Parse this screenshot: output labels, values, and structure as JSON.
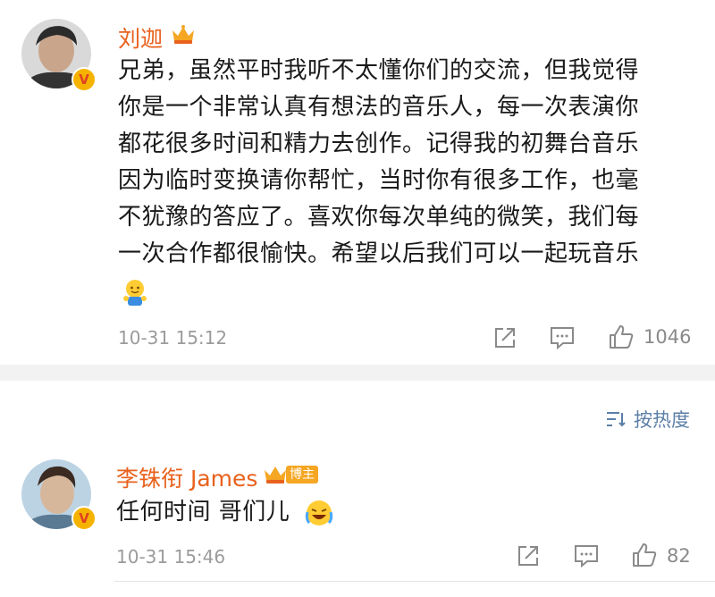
{
  "comments": [
    {
      "username": "刘迦",
      "body_lines": [
        "兄弟，虽然平时我听不太懂你们的交流，但我觉得",
        "你是一个非常认真有想法的音乐人，每一次表演你",
        "都花很多时间和精力去创作。记得我的初舞台音乐",
        "因为临时变换请你帮忙，当时你有很多工作，也毫",
        "不犹豫的答应了。喜欢你每次单纯的微笑，我们每",
        "一次合作都很愉快。希望以后我们可以一起玩音乐"
      ],
      "emoji": "hug-emoji",
      "time": "10-31 15:12",
      "likes": "1046",
      "verified_mark": "V"
    },
    {
      "username": "李铢衔 James",
      "tag": "博主",
      "body": "任何时间 哥们儿",
      "emoji": "laughing-cry-emoji",
      "time": "10-31 15:46",
      "likes": "82",
      "verified_mark": "V"
    }
  ],
  "sort_label": "按热度",
  "icons": {
    "share": "share-icon",
    "comment": "comment-icon",
    "like": "like-icon",
    "sort": "sort-icon",
    "crown": "crown-icon"
  },
  "colors": {
    "username": "#e8611d",
    "link": "#5b7fa6",
    "muted": "#9b9b9b",
    "verified": "#f5b300"
  }
}
